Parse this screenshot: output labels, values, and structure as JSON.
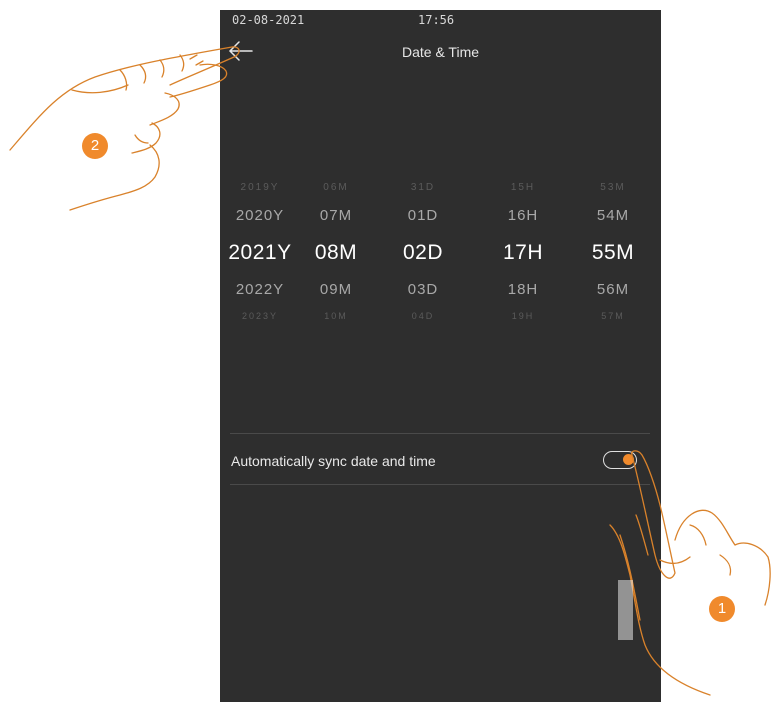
{
  "status_bar": {
    "date": "02-08-2021",
    "time": "17:56"
  },
  "header": {
    "title": "Date & Time",
    "back_icon": "back-arrow-icon"
  },
  "picker": {
    "columns": [
      {
        "name": "year",
        "items": [
          "2019Y",
          "2020Y",
          "2021Y",
          "2022Y",
          "2023Y"
        ],
        "selected": "2021Y"
      },
      {
        "name": "month",
        "items": [
          "06M",
          "07M",
          "08M",
          "09M",
          "10M"
        ],
        "selected": "08M"
      },
      {
        "name": "day",
        "items": [
          "31D",
          "01D",
          "02D",
          "03D",
          "04D"
        ],
        "selected": "02D"
      },
      {
        "name": "hour",
        "items": [
          "15H",
          "16H",
          "17H",
          "18H",
          "19H"
        ],
        "selected": "17H"
      },
      {
        "name": "minute",
        "items": [
          "53M",
          "54M",
          "55M",
          "56M",
          "57M"
        ],
        "selected": "55M"
      }
    ]
  },
  "settings": {
    "auto_sync_label": "Automatically sync date and time",
    "auto_sync_enabled": true
  },
  "annotations": {
    "step1": "1",
    "step2": "2",
    "accent_color": "#f08a2c"
  },
  "colors": {
    "screen_bg": "#2e2e2e",
    "accent": "#f08a2c"
  }
}
